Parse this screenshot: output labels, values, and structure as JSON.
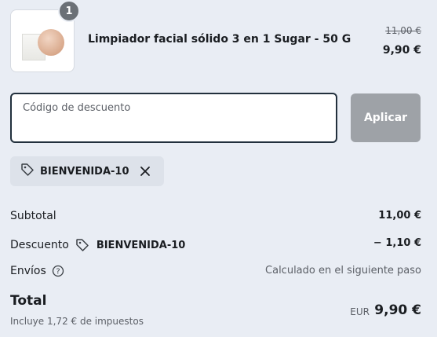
{
  "product": {
    "quantity": "1",
    "title": "Limpiador facial sólido 3 en 1 Sugar - 50 G",
    "price_original": "11,00 €",
    "price_current": "9,90 €"
  },
  "discount": {
    "placeholder": "Código de descuento",
    "value": "",
    "apply_label": "Aplicar",
    "applied_code": "BIENVENIDA-10"
  },
  "summary": {
    "subtotal_label": "Subtotal",
    "subtotal_value": "11,00 €",
    "discount_label": "Descuento",
    "discount_code": "BIENVENIDA-10",
    "discount_value": "− 1,10 €",
    "shipping_label": "Envíos",
    "shipping_value": "Calculado en el siguiente paso",
    "total_label": "Total",
    "tax_note": "Incluye 1,72 € de impuestos",
    "currency": "EUR",
    "total_value": "9,90 €"
  },
  "colors": {
    "background": "#e9edf4",
    "button_disabled": "#9ea2a7",
    "field_border": "#22303d"
  },
  "icons": [
    "tag-icon",
    "close-icon",
    "help-icon"
  ]
}
